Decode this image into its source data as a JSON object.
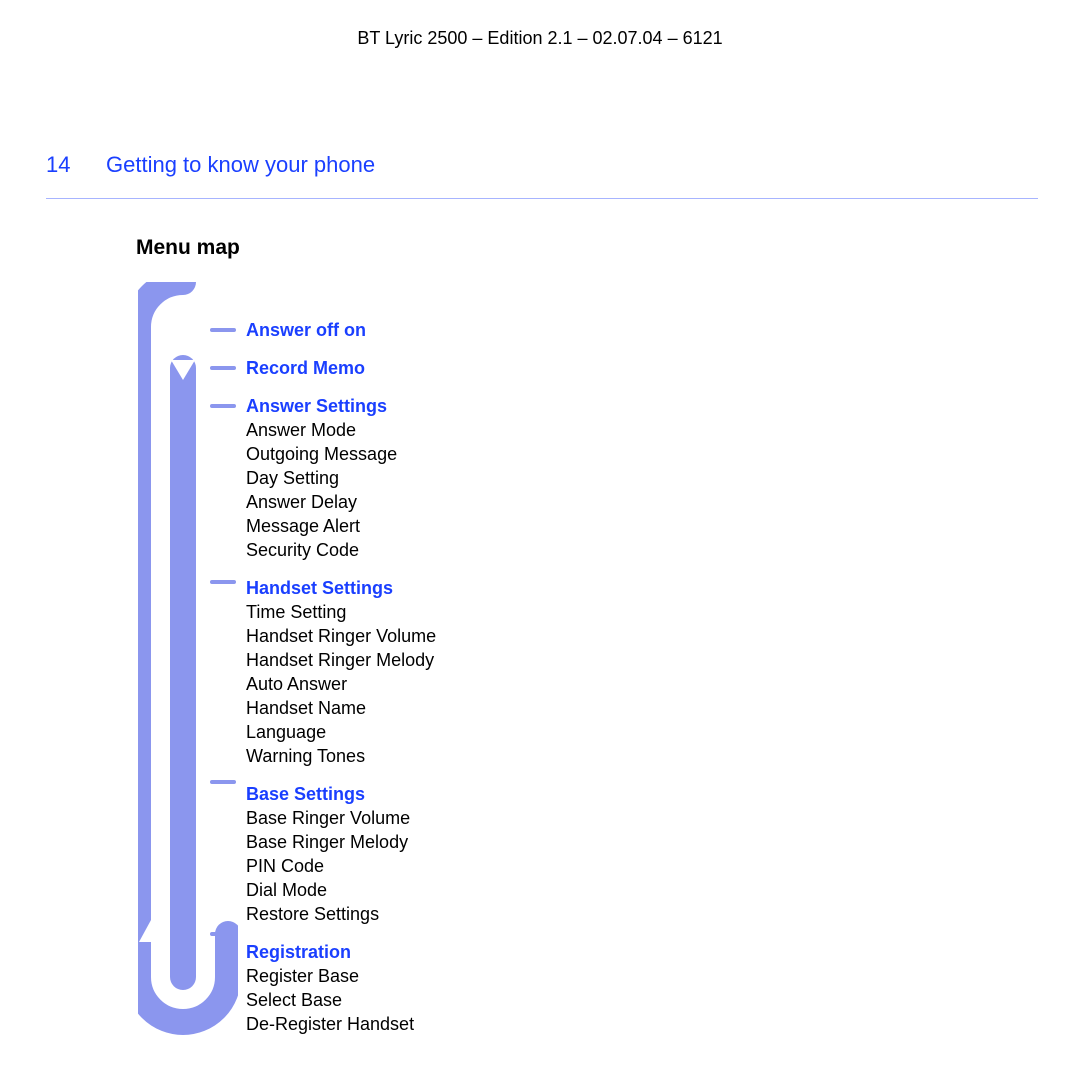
{
  "header": "BT Lyric 2500 – Edition 2.1 – 02.07.04 – 6121",
  "page_number": "14",
  "section_title": "Getting to know your phone",
  "subhead": "Menu map",
  "menu": [
    {
      "title": "Answer off on",
      "items": []
    },
    {
      "title": "Record Memo",
      "items": []
    },
    {
      "title": "Answer Settings",
      "items": [
        "Answer Mode",
        "Outgoing  Message",
        "Day Setting",
        "Answer Delay",
        "Message Alert",
        "Security Code"
      ]
    },
    {
      "title": "Handset Settings",
      "items": [
        "Time Setting",
        "Handset Ringer Volume",
        "Handset Ringer Melody",
        "Auto Answer",
        "Handset Name",
        "Language",
        "Warning Tones"
      ]
    },
    {
      "title": "Base Settings",
      "items": [
        "Base Ringer Volume",
        "Base Ringer Melody",
        "PIN Code",
        "Dial Mode",
        "Restore Settings"
      ]
    },
    {
      "title": "Registration",
      "items": [
        "Register Base",
        "Select Base",
        "De-Register Handset"
      ]
    }
  ]
}
